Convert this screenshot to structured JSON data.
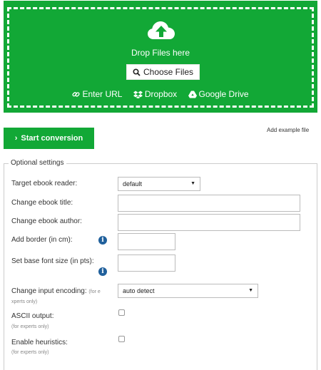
{
  "upload": {
    "drop_text": "Drop Files here",
    "choose_label": "Choose Files",
    "enter_url": "Enter URL",
    "dropbox": "Dropbox",
    "google_drive": "Google Drive"
  },
  "actions": {
    "start_label": "Start conversion",
    "add_example": "Add example file"
  },
  "settings": {
    "legend": "Optional settings",
    "target_reader": {
      "label": "Target ebook reader:",
      "value": "default"
    },
    "title": {
      "label": "Change ebook title:",
      "value": ""
    },
    "author": {
      "label": "Change ebook author:",
      "value": ""
    },
    "border": {
      "label": "Add border (in cm):",
      "value": ""
    },
    "base_font": {
      "label": "Set base font size (in pts):",
      "value": ""
    },
    "encoding": {
      "label": "Change input encoding:",
      "note_a": "(for e",
      "note_b": "xperts only)",
      "value": "auto detect"
    },
    "ascii": {
      "label": "ASCII output:",
      "note": "(for experts only)",
      "checked": false
    },
    "heuristics": {
      "label": "Enable heuristics:",
      "note": "(for experts only)",
      "checked": false
    }
  },
  "colors": {
    "accent": "#12a836",
    "info": "#20609c"
  }
}
